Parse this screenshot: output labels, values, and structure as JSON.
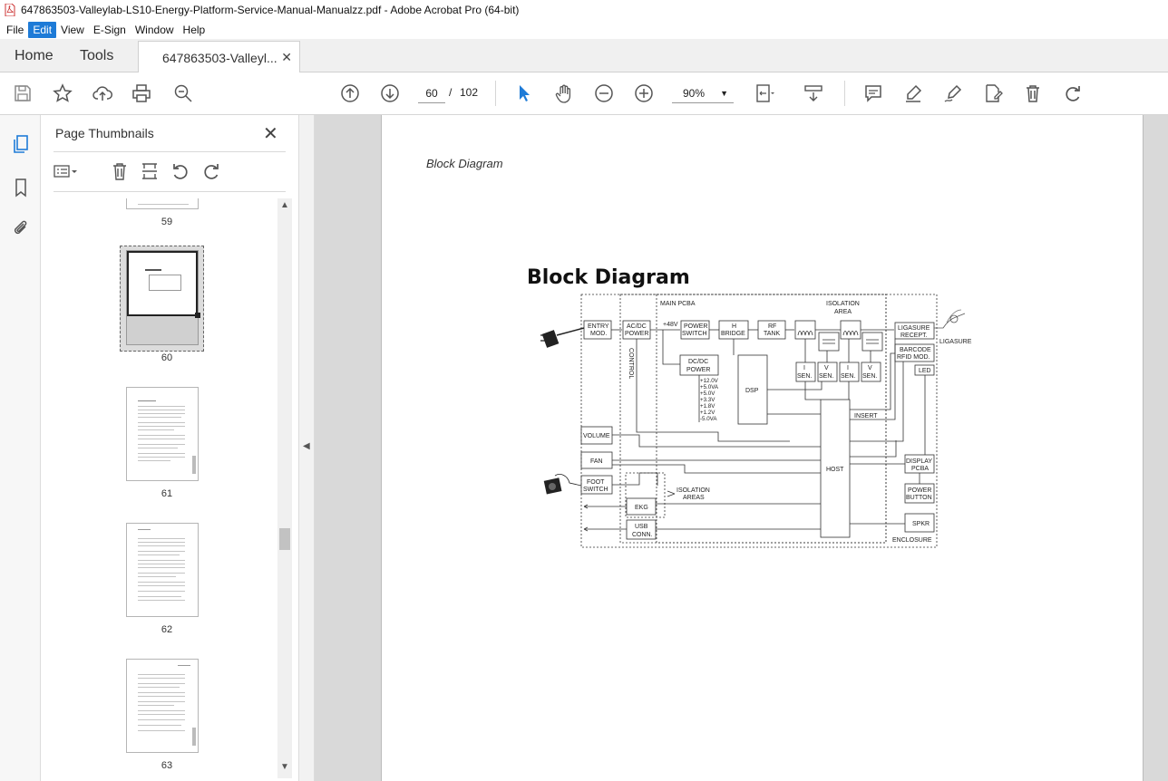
{
  "window": {
    "title": "647863503-Valleylab-LS10-Energy-Platform-Service-Manual-Manualzz.pdf - Adobe Acrobat Pro (64-bit)"
  },
  "menu": [
    "File",
    "Edit",
    "View",
    "E-Sign",
    "Window",
    "Help"
  ],
  "tabs": {
    "home": "Home",
    "tools": "Tools",
    "document": "647863503-Valleyl..."
  },
  "toolbar": {
    "page_current": "60",
    "page_sep": "/",
    "page_total": "102",
    "zoom": "90%"
  },
  "panel": {
    "title": "Page Thumbnails",
    "thumbnails": [
      {
        "label": "59"
      },
      {
        "label": "60"
      },
      {
        "label": "61"
      },
      {
        "label": "62"
      },
      {
        "label": "63"
      }
    ]
  },
  "document": {
    "header": "Block Diagram",
    "diagram_title": "Block Diagram",
    "diagram": {
      "main_pcba": "MAIN PCBA",
      "isolation_area": [
        "ISOLATION",
        "AREA"
      ],
      "entry_mod": [
        "ENTRY",
        "MOD."
      ],
      "acdc_power": [
        "AC/DC",
        "POWER"
      ],
      "v48": "+48V",
      "power_switch": [
        "POWER",
        "SWITCH"
      ],
      "h_bridge": [
        "H",
        "BRIDGE"
      ],
      "rf_tank": [
        "RF",
        "TANK"
      ],
      "control": "CONTROL",
      "dcdc_power": [
        "DC/DC",
        "POWER"
      ],
      "voltages": [
        "+12.0V",
        "+5.0VA",
        "+5.0V",
        "+3.3V",
        "+1.8V",
        "+1.2V",
        "-5.0VA"
      ],
      "dsp": "DSP",
      "i_sen": [
        "I",
        "SEN."
      ],
      "v_sen": [
        "V",
        "SEN."
      ],
      "insert": "INSERT",
      "ligasure_recept": [
        "LIGASURE",
        "RECEPT."
      ],
      "barcode": [
        "BARCODE",
        "RFID MOD."
      ],
      "led": "LED",
      "ligasure": "LIGASURE",
      "volume": "VOLUME",
      "fan": "FAN",
      "host": "HOST",
      "display_pcba": [
        "DISPLAY",
        "PCBA"
      ],
      "foot_switch": [
        "FOOT",
        "SWITCH"
      ],
      "isolation_areas": [
        "ISOLATION",
        "AREAS"
      ],
      "power_button": [
        "POWER",
        "BUTTON"
      ],
      "ekg": "EKG",
      "usb_conn": [
        "USB",
        "CONN."
      ],
      "spkr": "SPKR",
      "enclosure": "ENCLOSURE"
    }
  }
}
